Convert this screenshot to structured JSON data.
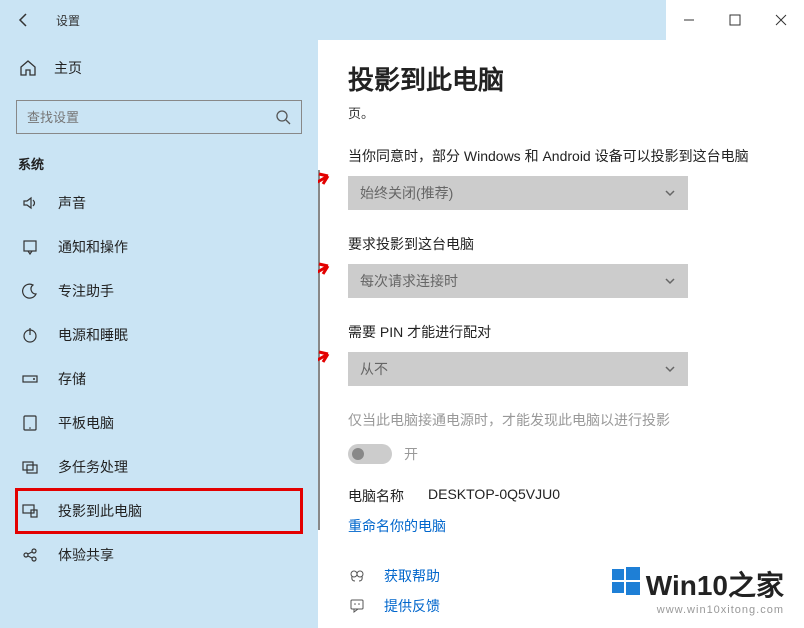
{
  "titlebar": {
    "title": "设置"
  },
  "sidebar": {
    "home": "主页",
    "search_placeholder": "查找设置",
    "section": "系统",
    "items": [
      {
        "label": "声音"
      },
      {
        "label": "通知和操作"
      },
      {
        "label": "专注助手"
      },
      {
        "label": "电源和睡眠"
      },
      {
        "label": "存储"
      },
      {
        "label": "平板电脑"
      },
      {
        "label": "多任务处理"
      },
      {
        "label": "投影到此电脑"
      },
      {
        "label": "体验共享"
      }
    ]
  },
  "page": {
    "title": "投影到此电脑",
    "subtitle": "页。",
    "opt1_label": "当你同意时，部分 Windows 和 Android 设备可以投影到这台电脑",
    "opt1_value": "始终关闭(推荐)",
    "opt2_label": "要求投影到这台电脑",
    "opt2_value": "每次请求连接时",
    "opt3_label": "需要 PIN 才能进行配对",
    "opt3_value": "从不",
    "opt4_label": "仅当此电脑接通电源时，才能发现此电脑以进行投影",
    "toggle_state": "开",
    "pc_name_label": "电脑名称",
    "pc_name_value": "DESKTOP-0Q5VJU0",
    "rename_link": "重命名你的电脑",
    "help": "获取帮助",
    "feedback": "提供反馈"
  },
  "watermark": {
    "brand_a": "Win10",
    "brand_b": "之家",
    "url": "www.win10xitong.com"
  }
}
